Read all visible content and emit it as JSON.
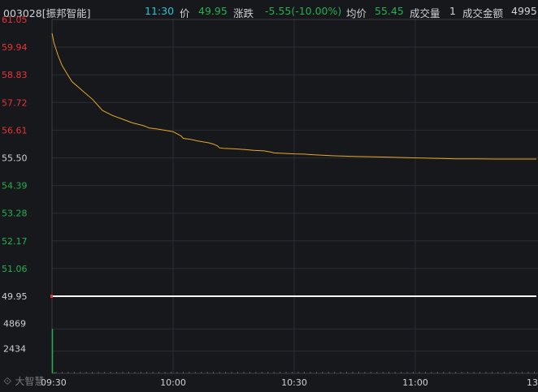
{
  "header": {
    "code_name": "003028[振邦智能]",
    "time": "11:30",
    "price_label": "价",
    "price": "49.95",
    "change_label": "涨跌",
    "change": "-5.55(-10.00%)",
    "avg_label": "均价",
    "avg": "55.45",
    "volume_label": "成交量",
    "volume": "1",
    "amount_label": "成交金额",
    "amount": "4995"
  },
  "watermark": "大智慧",
  "colors": {
    "up": "#e8333a",
    "down": "#23b14d",
    "avg_line": "#e8a822",
    "price_line": "#ffffff",
    "grid": "#2a2d33",
    "header_time": "#29c3d6",
    "header_value": "#23b14d"
  },
  "chart_data": {
    "type": "line",
    "price_ticks": [
      "61.05",
      "59.94",
      "58.83",
      "57.72",
      "56.61",
      "55.50",
      "54.39",
      "53.28",
      "52.17",
      "51.06",
      "49.95"
    ],
    "volume_ticks": [
      "4869",
      "2434"
    ],
    "x_ticks": [
      "09:30",
      "10:00",
      "10:30",
      "11:00",
      "13:"
    ],
    "ylim": [
      49.95,
      61.05
    ],
    "prev_close": 55.5,
    "series": [
      {
        "role": "avg",
        "x": [
          0,
          1,
          2,
          3,
          5,
          8,
          10,
          15,
          20,
          25,
          30,
          35,
          40,
          45,
          47,
          48,
          52,
          55,
          60,
          64,
          65,
          68,
          70,
          72,
          78,
          80,
          82,
          83,
          85,
          90,
          95,
          100,
          105,
          108,
          110,
          115,
          120,
          125,
          130,
          135,
          140,
          150,
          160,
          170,
          180,
          190,
          195,
          200,
          210,
          220,
          230,
          240
        ],
        "y": [
          60.5,
          60.1,
          59.85,
          59.6,
          59.2,
          58.8,
          58.55,
          58.2,
          57.85,
          57.4,
          57.2,
          57.05,
          56.9,
          56.8,
          56.74,
          56.7,
          56.66,
          56.62,
          56.55,
          56.38,
          56.28,
          56.25,
          56.22,
          56.18,
          56.1,
          56.05,
          55.98,
          55.9,
          55.88,
          55.86,
          55.84,
          55.8,
          55.78,
          55.74,
          55.7,
          55.68,
          55.66,
          55.65,
          55.62,
          55.6,
          55.58,
          55.56,
          55.54,
          55.52,
          55.5,
          55.48,
          55.47,
          55.46,
          55.46,
          55.45,
          55.45,
          55.45
        ]
      },
      {
        "role": "price",
        "x": [
          0,
          240
        ],
        "y": [
          49.95,
          49.95
        ]
      }
    ],
    "volume": {
      "x": [
        0,
        1
      ],
      "values": [
        4869,
        1
      ],
      "ymax": 7303
    }
  }
}
